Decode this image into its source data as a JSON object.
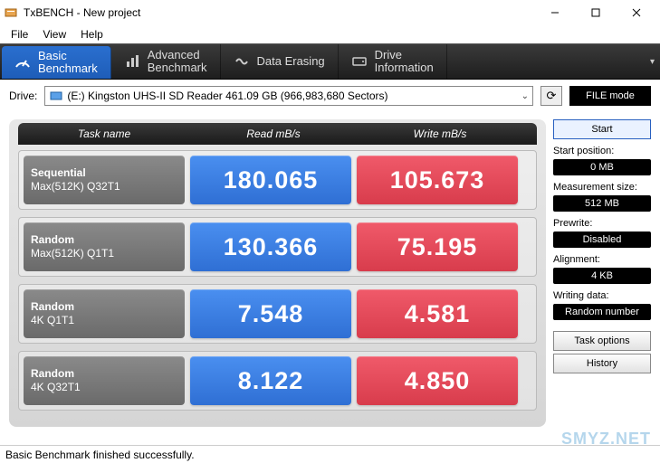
{
  "window": {
    "title": "TxBENCH - New project"
  },
  "menu": {
    "file": "File",
    "view": "View",
    "help": "Help"
  },
  "tabs": {
    "basic": "Basic\nBenchmark",
    "advanced": "Advanced\nBenchmark",
    "erasing": "Data Erasing",
    "driveinfo": "Drive\nInformation"
  },
  "drive": {
    "label": "Drive:",
    "selected": "(E:) Kingston UHS-II SD Reader  461.09 GB (966,983,680 Sectors)"
  },
  "file_mode": "FILE mode",
  "headers": {
    "task": "Task name",
    "read": "Read mB/s",
    "write": "Write mB/s"
  },
  "rows": [
    {
      "t1": "Sequential",
      "t2": "Max(512K) Q32T1",
      "read": "180.065",
      "write": "105.673"
    },
    {
      "t1": "Random",
      "t2": "Max(512K) Q1T1",
      "read": "130.366",
      "write": "75.195"
    },
    {
      "t1": "Random",
      "t2": "4K Q1T1",
      "read": "7.548",
      "write": "4.581"
    },
    {
      "t1": "Random",
      "t2": "4K Q32T1",
      "read": "8.122",
      "write": "4.850"
    }
  ],
  "side": {
    "start": "Start",
    "startpos_label": "Start position:",
    "startpos": "0 MB",
    "meassize_label": "Measurement size:",
    "meassize": "512 MB",
    "prewrite_label": "Prewrite:",
    "prewrite": "Disabled",
    "align_label": "Alignment:",
    "align": "4 KB",
    "writedata_label": "Writing data:",
    "writedata": "Random number",
    "taskopt": "Task options",
    "history": "History"
  },
  "status": "Basic Benchmark finished successfully.",
  "watermark": "SMYZ.NET"
}
